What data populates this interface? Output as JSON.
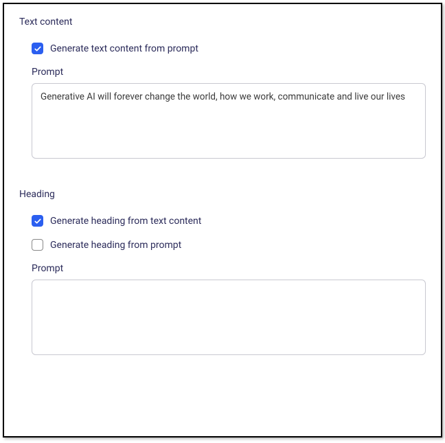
{
  "textContent": {
    "title": "Text content",
    "generateFromPrompt": {
      "label": "Generate text content from prompt",
      "checked": true
    },
    "promptLabel": "Prompt",
    "promptValue": "Generative AI will forever change the world, how we work, communicate and live our lives"
  },
  "heading": {
    "title": "Heading",
    "generateFromTextContent": {
      "label": "Generate heading from text content",
      "checked": true
    },
    "generateFromPrompt": {
      "label": "Generate heading from prompt",
      "checked": false
    },
    "promptLabel": "Prompt",
    "promptValue": ""
  }
}
